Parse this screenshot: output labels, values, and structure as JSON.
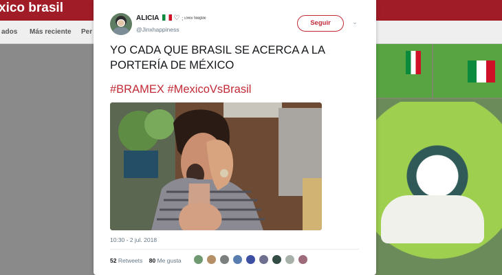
{
  "page": {
    "brand_title": "xico brasil",
    "nav": [
      "ados",
      "Más reciente",
      "Per"
    ]
  },
  "tweet": {
    "display_name": "ALICIA",
    "name_suffix": "; ᶫᵒᵛᵉᵘ ᵇᵃᵉᵍᵗᵃᵉ",
    "handle": "@Jinxhappiness",
    "follow_label": "Seguir",
    "text": "YO CADA QUE BRASIL SE ACERCA A LA PORTERÍA DE MÉXICO",
    "hashtags": "#BRAMEX #MexicoVsBrasil",
    "timestamp": "10:30 - 2 jul. 2018",
    "retweets_count": "52",
    "retweets_label": "Retweets",
    "likes_count": "80",
    "likes_label": "Me gusta"
  },
  "colors": {
    "accent": "#c22a36",
    "topbar": "#a01c27"
  },
  "icons": [
    "mexico-flag-icon",
    "heart-icon",
    "chevron-down-icon"
  ],
  "liker_avatar_colors": [
    "#6f9a71",
    "#b58f66",
    "#7b7f7e",
    "#5a7db0",
    "#3c4fa3",
    "#6f6f8f",
    "#334b45",
    "#a8b0aa",
    "#9f6a79"
  ]
}
